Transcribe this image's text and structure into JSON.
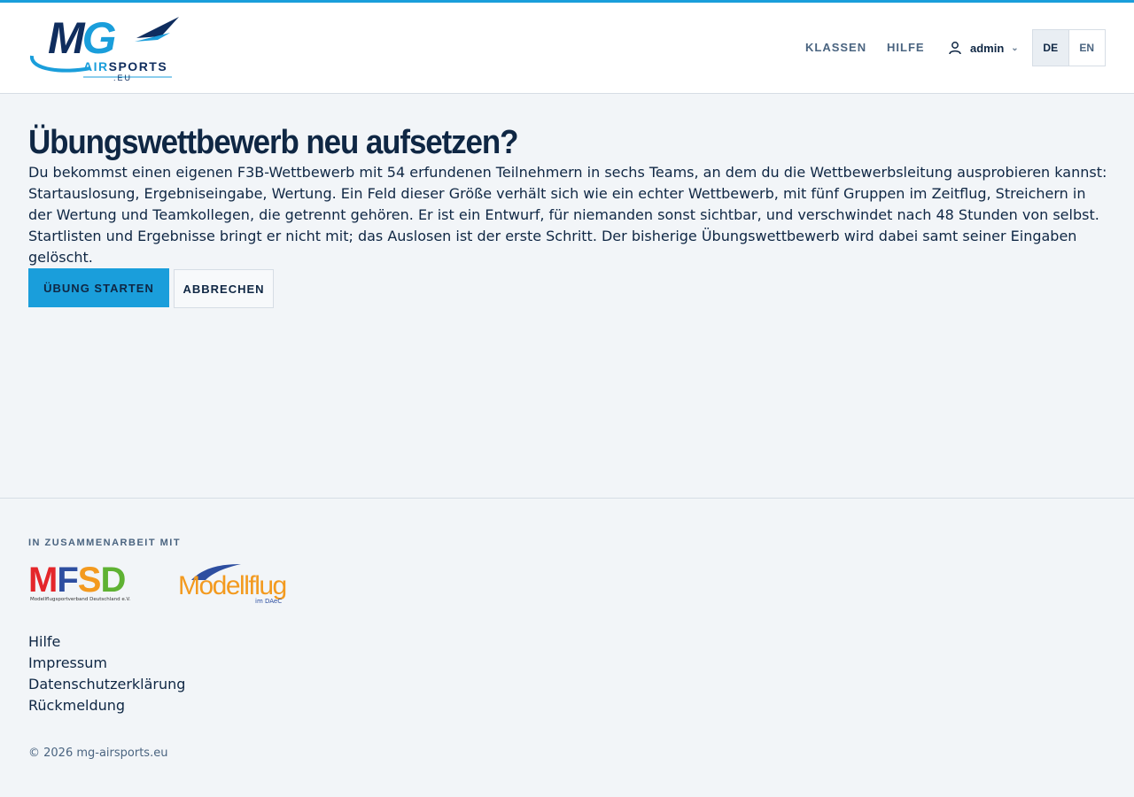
{
  "header": {
    "logo": {
      "letters_m": "M",
      "letters_g": "G",
      "air": "AIR",
      "sports": "SPORTS",
      "tld": ".EU"
    },
    "nav": {
      "classes": "KLASSEN",
      "help": "HILFE"
    },
    "user": {
      "name": "admin",
      "icon": "user-icon",
      "chevron": "⌄"
    },
    "languages": {
      "de": "DE",
      "en": "EN",
      "active": "DE"
    }
  },
  "main": {
    "title": "Übungswettbewerb neu aufsetzen?",
    "intro": "Du bekommst einen eigenen F3B-Wettbewerb mit 54 erfundenen Teilnehmern in sechs Teams, an dem du die Wettbewerbsleitung ausprobieren kannst: Startauslosung, Ergebniseingabe, Wertung. Ein Feld dieser Größe verhält sich wie ein echter Wettbewerb, mit fünf Gruppen im Zeitflug, Streichern in der Wertung und Teamkollegen, die getrennt gehören. Er ist ein Entwurf, für niemanden sonst sichtbar, und verschwindet nach 48 Stunden von selbst. Startlisten und Ergebnisse bringt er nicht mit; das Auslosen ist der erste Schritt. Der bisherige Übungswettbewerb wird dabei samt seiner Eingaben gelöscht.",
    "buttons": {
      "start": "ÜBUNG STARTEN",
      "cancel": "ABBRECHEN"
    }
  },
  "footer": {
    "cooperation_label": "IN ZUSAMMENARBEIT MIT",
    "partners": {
      "mfsd": {
        "m": "M",
        "f": "F",
        "s": "S",
        "d": "D",
        "subtitle": "Modellflugsportverband Deutschland e.V."
      },
      "modellflug": {
        "name": "Modellflug",
        "subtitle": "im DAeC"
      }
    },
    "links": [
      "Hilfe",
      "Impressum",
      "Datenschutzerklärung",
      "Rückmeldung"
    ],
    "copyright": "© 2026 mg-airsports.eu"
  },
  "colors": {
    "accent": "#1a9edb",
    "navy": "#0f2744",
    "background": "#f2f5f8"
  }
}
